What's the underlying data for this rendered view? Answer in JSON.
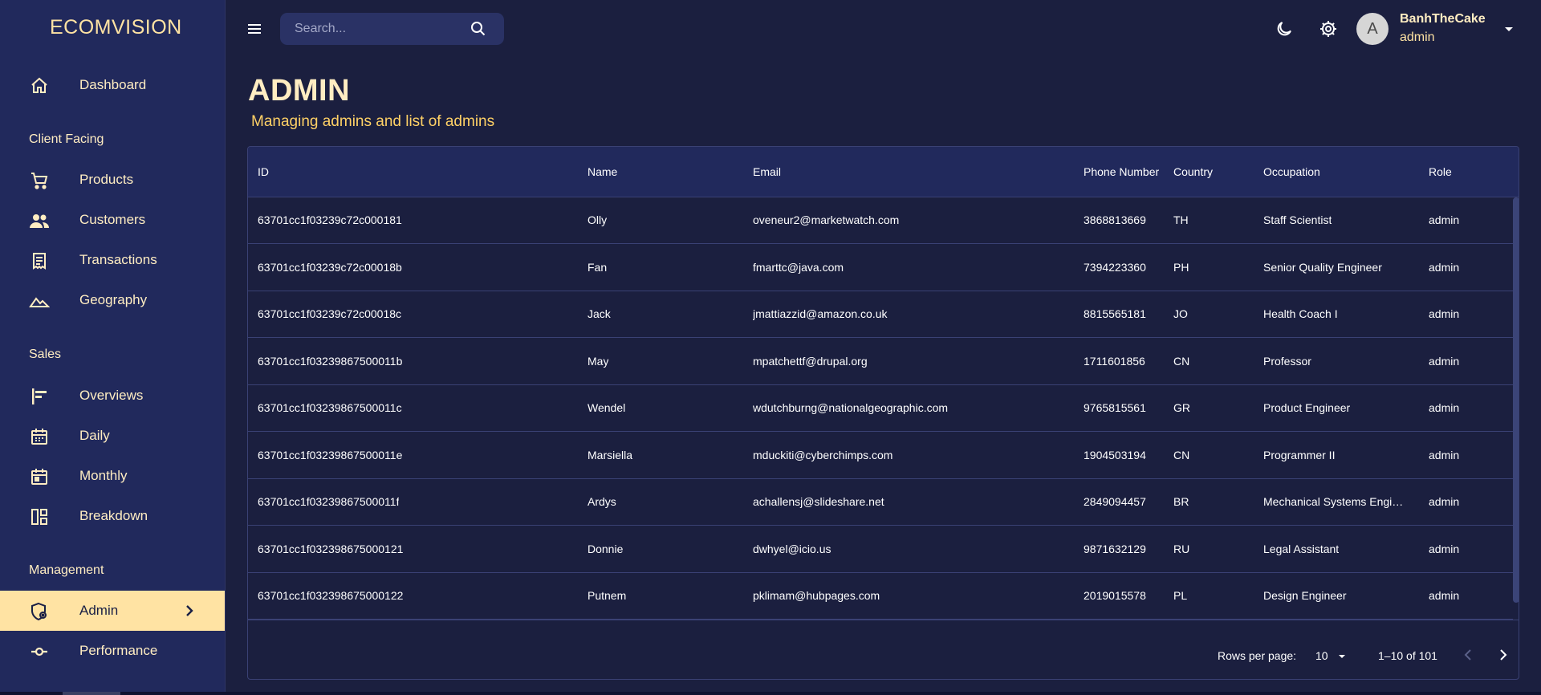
{
  "brand": "ECOMVISION",
  "sidebar": {
    "items": [
      {
        "label": "Dashboard",
        "icon": "home-icon"
      },
      {
        "label": "Products",
        "icon": "cart-icon"
      },
      {
        "label": "Customers",
        "icon": "people-icon"
      },
      {
        "label": "Transactions",
        "icon": "receipt-icon"
      },
      {
        "label": "Geography",
        "icon": "terrain-icon"
      },
      {
        "label": "Overviews",
        "icon": "bars-icon"
      },
      {
        "label": "Daily",
        "icon": "calendar-icon"
      },
      {
        "label": "Monthly",
        "icon": "calendar-month-icon"
      },
      {
        "label": "Breakdown",
        "icon": "pie-layout-icon"
      },
      {
        "label": "Admin",
        "icon": "admin-shield-icon"
      },
      {
        "label": "Performance",
        "icon": "commit-icon"
      }
    ],
    "sections": [
      "Client Facing",
      "Sales",
      "Management"
    ]
  },
  "search": {
    "placeholder": "Search..."
  },
  "user": {
    "initial": "A",
    "name": "BanhTheCake",
    "role": "admin"
  },
  "page": {
    "title": "ADMIN",
    "subtitle": "Managing admins and list of admins"
  },
  "table": {
    "columns": [
      "ID",
      "Name",
      "Email",
      "Phone Number",
      "Country",
      "Occupation",
      "Role"
    ],
    "rows": [
      [
        "63701cc1f03239c72c000181",
        "Olly",
        "oveneur2@marketwatch.com",
        "3868813669",
        "TH",
        "Staff Scientist",
        "admin"
      ],
      [
        "63701cc1f03239c72c00018b",
        "Fan",
        "fmarttc@java.com",
        "7394223360",
        "PH",
        "Senior Quality Engineer",
        "admin"
      ],
      [
        "63701cc1f03239c72c00018c",
        "Jack",
        "jmattiazzid@amazon.co.uk",
        "8815565181",
        "JO",
        "Health Coach I",
        "admin"
      ],
      [
        "63701cc1f03239867500011b",
        "May",
        "mpatchettf@drupal.org",
        "1711601856",
        "CN",
        "Professor",
        "admin"
      ],
      [
        "63701cc1f03239867500011c",
        "Wendel",
        "wdutchburng@nationalgeographic.com",
        "9765815561",
        "GR",
        "Product Engineer",
        "admin"
      ],
      [
        "63701cc1f03239867500011e",
        "Marsiella",
        "mduckiti@cyberchimps.com",
        "1904503194",
        "CN",
        "Programmer II",
        "admin"
      ],
      [
        "63701cc1f03239867500011f",
        "Ardys",
        "achallensj@slideshare.net",
        "2849094457",
        "BR",
        "Mechanical Systems Engin…",
        "admin"
      ],
      [
        "63701cc1f032398675000121",
        "Donnie",
        "dwhyel@icio.us",
        "9871632129",
        "RU",
        "Legal Assistant",
        "admin"
      ],
      [
        "63701cc1f032398675000122",
        "Putnem",
        "pklimam@hubpages.com",
        "2019015578",
        "PL",
        "Design Engineer",
        "admin"
      ]
    ]
  },
  "pagination": {
    "rows_per_page_label": "Rows per page:",
    "rows_per_page": "10",
    "range": "1–10 of 101"
  },
  "colors": {
    "sidebar_bg": "#21295c",
    "page_bg": "#1b1f3f",
    "accent": "#ffe3a3",
    "subtitle": "#ffd166"
  }
}
